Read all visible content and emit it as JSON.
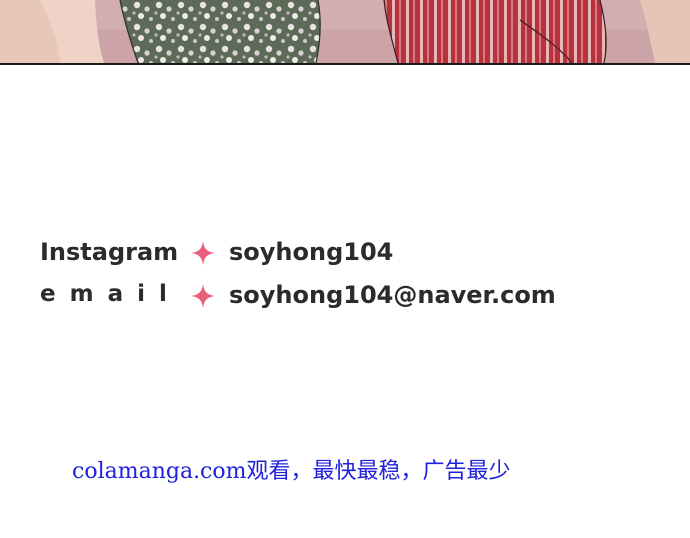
{
  "panel": {
    "description_icon": "manga-panel-image"
  },
  "contact": {
    "instagram": {
      "label": "Instagram",
      "icon": "sparkle-icon",
      "value": "soyhong104"
    },
    "email": {
      "label": "email",
      "icon": "sparkle-icon",
      "value": "soyhong104@naver.com"
    }
  },
  "site_note": {
    "text": "colamanga.com观看，最快最稳，广告最少"
  },
  "colors": {
    "sparkle": "#e8607a",
    "contact_text": "#2b2b2b",
    "site_note": "#2020dd"
  }
}
